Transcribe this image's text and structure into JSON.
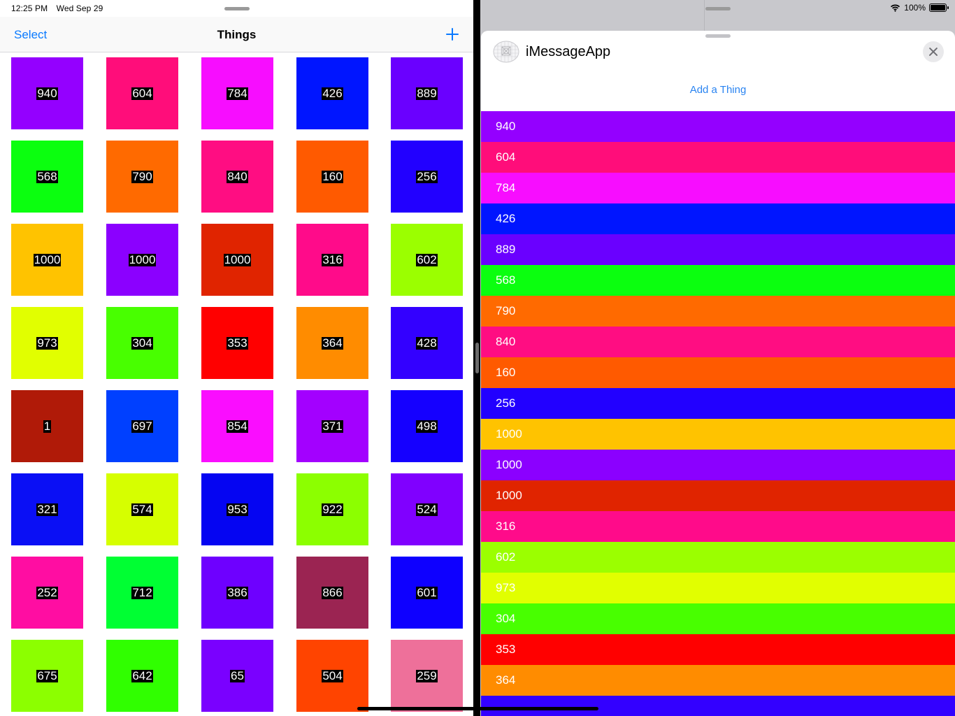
{
  "status_left": {
    "time": "12:25 PM",
    "date": "Wed Sep 29"
  },
  "status_right": {
    "battery": "100%"
  },
  "navbar": {
    "select_label": "Select",
    "title": "Things",
    "add_icon": "plus-icon"
  },
  "tiles": [
    {
      "label": "940",
      "color": "#9400FF"
    },
    {
      "label": "604",
      "color": "#FF0D7A"
    },
    {
      "label": "784",
      "color": "#F70DFF"
    },
    {
      "label": "426",
      "color": "#0015FF"
    },
    {
      "label": "889",
      "color": "#6A00FF"
    },
    {
      "label": "568",
      "color": "#0BFF0F"
    },
    {
      "label": "790",
      "color": "#FF6A00"
    },
    {
      "label": "840",
      "color": "#FF0D82"
    },
    {
      "label": "160",
      "color": "#FF5A00"
    },
    {
      "label": "256",
      "color": "#2200FF"
    },
    {
      "label": "1000",
      "color": "#FFC300"
    },
    {
      "label": "1000",
      "color": "#8B00FF"
    },
    {
      "label": "1000",
      "color": "#E02400"
    },
    {
      "label": "316",
      "color": "#FF0B8A"
    },
    {
      "label": "602",
      "color": "#9BFF00"
    },
    {
      "label": "973",
      "color": "#E1FF00"
    },
    {
      "label": "304",
      "color": "#48FF00"
    },
    {
      "label": "353",
      "color": "#FF0000"
    },
    {
      "label": "364",
      "color": "#FF8C00"
    },
    {
      "label": "428",
      "color": "#3300FF"
    },
    {
      "label": "1",
      "color": "#B01A08"
    },
    {
      "label": "697",
      "color": "#0040FF"
    },
    {
      "label": "854",
      "color": "#FA0DFF"
    },
    {
      "label": "371",
      "color": "#A300FF"
    },
    {
      "label": "498",
      "color": "#1500FF"
    },
    {
      "label": "321",
      "color": "#0A0FF5"
    },
    {
      "label": "574",
      "color": "#D6FF00"
    },
    {
      "label": "953",
      "color": "#0505F2"
    },
    {
      "label": "922",
      "color": "#8CFF00"
    },
    {
      "label": "524",
      "color": "#8000FF"
    },
    {
      "label": "252",
      "color": "#FF0DA2"
    },
    {
      "label": "712",
      "color": "#00FF33"
    },
    {
      "label": "386",
      "color": "#6E00FF"
    },
    {
      "label": "866",
      "color": "#9B2452"
    },
    {
      "label": "601",
      "color": "#0E00FF"
    },
    {
      "label": "675",
      "color": "#8CFF00"
    },
    {
      "label": "642",
      "color": "#30FF00"
    },
    {
      "label": "65",
      "color": "#7A00FF"
    },
    {
      "label": "504",
      "color": "#FF4400"
    },
    {
      "label": "259",
      "color": "#EE709A"
    }
  ],
  "sheet": {
    "app_name": "iMessageApp",
    "add_thing_label": "Add a Thing",
    "close_icon": "close-icon"
  },
  "list_items": [
    {
      "label": "940",
      "color": "#9400FF"
    },
    {
      "label": "604",
      "color": "#FF0D7A"
    },
    {
      "label": "784",
      "color": "#F70DFF"
    },
    {
      "label": "426",
      "color": "#0015FF"
    },
    {
      "label": "889",
      "color": "#6A00FF"
    },
    {
      "label": "568",
      "color": "#0BFF0F"
    },
    {
      "label": "790",
      "color": "#FF6A00"
    },
    {
      "label": "840",
      "color": "#FF0D82"
    },
    {
      "label": "160",
      "color": "#FF5A00"
    },
    {
      "label": "256",
      "color": "#2200FF"
    },
    {
      "label": "1000",
      "color": "#FFC300"
    },
    {
      "label": "1000",
      "color": "#8B00FF"
    },
    {
      "label": "1000",
      "color": "#E02400"
    },
    {
      "label": "316",
      "color": "#FF0B8A"
    },
    {
      "label": "602",
      "color": "#9BFF00"
    },
    {
      "label": "973",
      "color": "#E1FF00"
    },
    {
      "label": "304",
      "color": "#48FF00"
    },
    {
      "label": "353",
      "color": "#FF0000"
    },
    {
      "label": "364",
      "color": "#FF8C00"
    },
    {
      "label": "",
      "color": "#3300FF"
    }
  ]
}
